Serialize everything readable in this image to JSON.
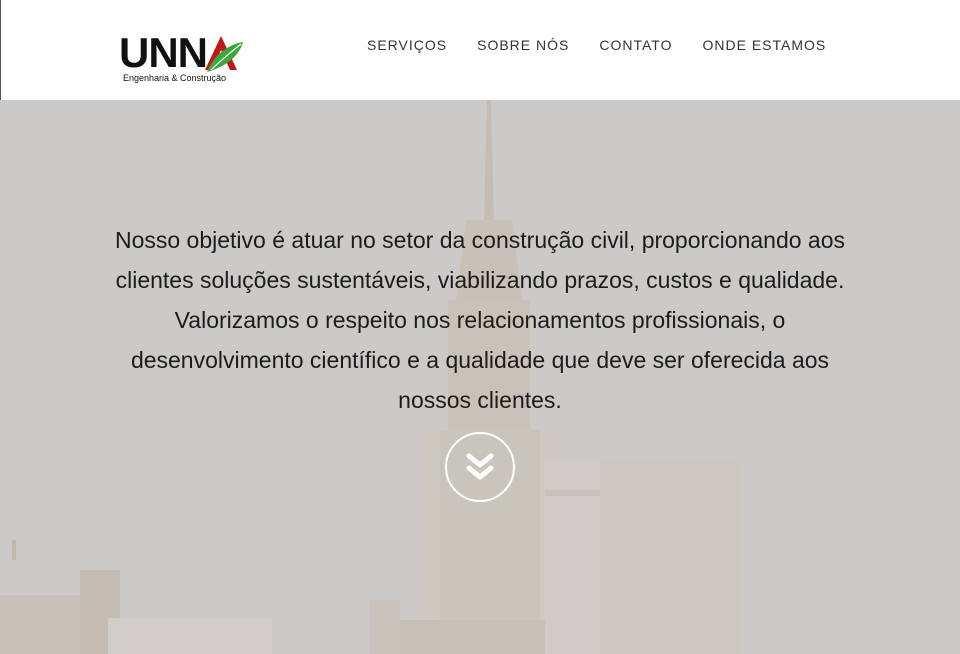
{
  "header": {
    "logo": {
      "word": "UNN",
      "tagline": "Engenharia & Construção"
    },
    "nav": [
      {
        "label": "SERVIÇOS"
      },
      {
        "label": "SOBRE NÓS"
      },
      {
        "label": "CONTATO"
      },
      {
        "label": "ONDE ESTAMOS"
      }
    ]
  },
  "hero": {
    "mission_text": "Nosso objetivo é atuar no setor da construção civil, proporcionando aos clientes soluções sustentáveis, viabilizando prazos, custos e qualidade. Valorizamos o respeito nos relacionamentos profissionais, o desenvolvimento científico e a qualidade que deve ser oferecida aos nossos clientes.",
    "scroll_icon": "double-chevron-down-icon",
    "background_image": "city-skyline-photo"
  },
  "colors": {
    "logo_red": "#c0161c",
    "logo_green": "#3aa83a",
    "hero_bg": "#c9c8c6"
  }
}
